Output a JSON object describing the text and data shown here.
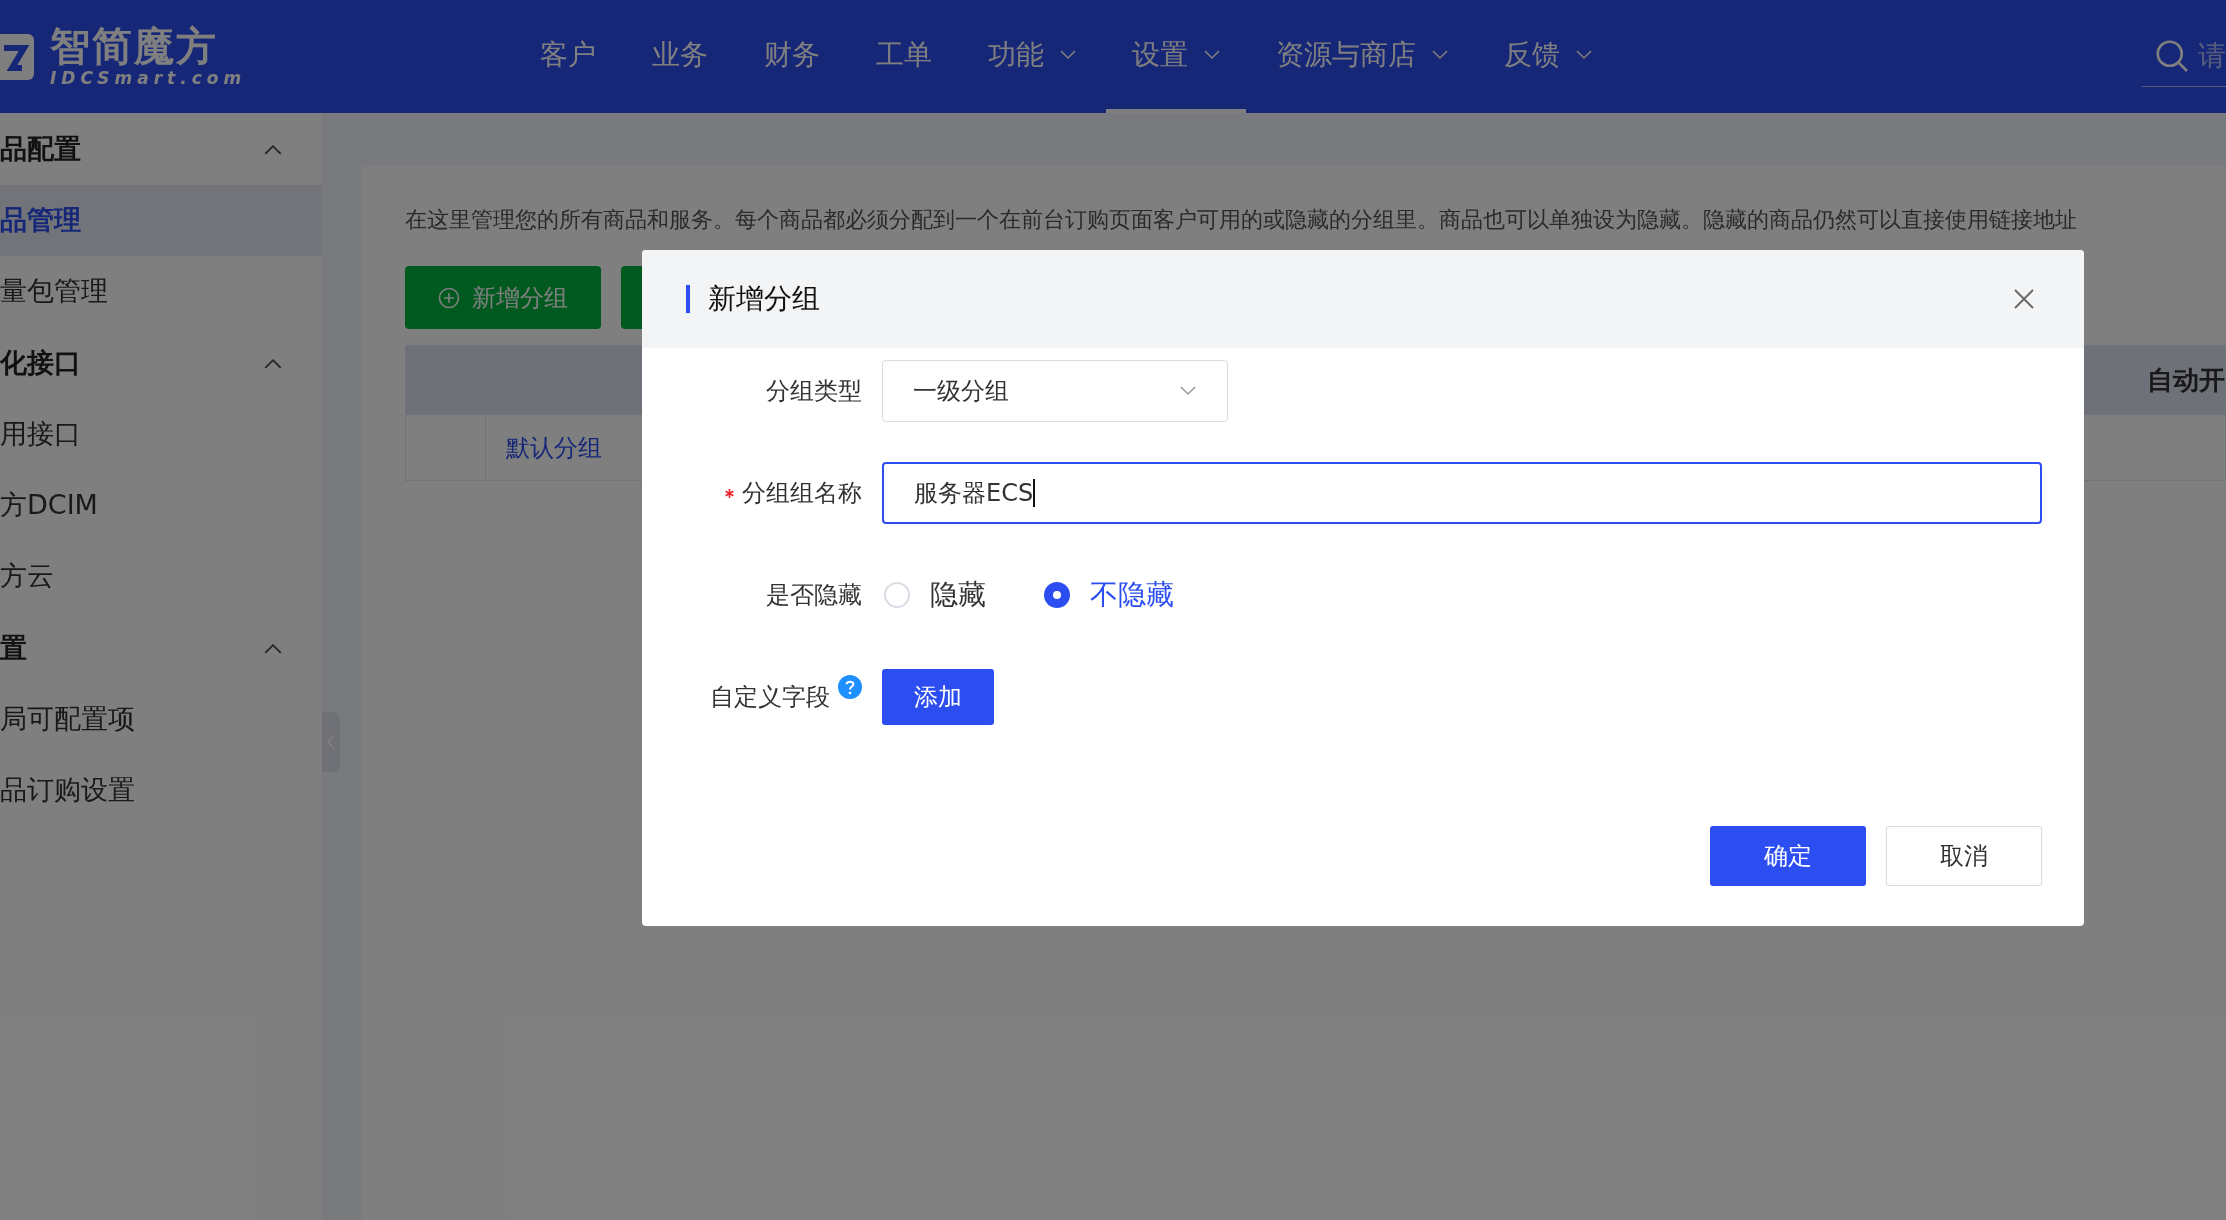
{
  "header": {
    "logo": {
      "name": "智简魔方",
      "domain": "IDCSmart.com"
    },
    "nav": [
      {
        "label": "客户",
        "has_menu": false,
        "selected": false
      },
      {
        "label": "业务",
        "has_menu": false,
        "selected": false
      },
      {
        "label": "财务",
        "has_menu": false,
        "selected": false
      },
      {
        "label": "工单",
        "has_menu": false,
        "selected": false
      },
      {
        "label": "功能",
        "has_menu": true,
        "selected": false
      },
      {
        "label": "设置",
        "has_menu": true,
        "selected": true
      },
      {
        "label": "资源与商店",
        "has_menu": true,
        "selected": false
      },
      {
        "label": "反馈",
        "has_menu": true,
        "selected": false
      }
    ],
    "search": {
      "placeholder": "请"
    }
  },
  "sidebar": {
    "groups": [
      {
        "title": "品配置",
        "expanded": true,
        "items": [
          {
            "label": "品管理",
            "selected": true
          },
          {
            "label": "量包管理",
            "selected": false
          }
        ]
      },
      {
        "title": "化接口",
        "expanded": true,
        "items": [
          {
            "label": "用接口",
            "selected": false
          },
          {
            "label": "方DCIM",
            "selected": false
          },
          {
            "label": "方云",
            "selected": false
          }
        ]
      },
      {
        "title": "置",
        "expanded": true,
        "items": [
          {
            "label": "局可配置项",
            "selected": false
          },
          {
            "label": "品订购设置",
            "selected": false
          }
        ]
      }
    ]
  },
  "content": {
    "description": "在这里管理您的所有商品和服务。每个商品都必须分配到一个在前台订购页面客户可用的或隐藏的分组里。商品也可以单独设为隐藏。隐藏的商品仍然可以直接使用链接地址",
    "add_button": "新增分组",
    "table": {
      "last_column": "自动开",
      "rows": [
        {
          "name": "默认分组"
        }
      ]
    }
  },
  "dialog": {
    "title": "新增分组",
    "fields": [
      {
        "kind": "select",
        "label": "分组类型",
        "value": "一级分组",
        "required": false,
        "focused": false
      },
      {
        "kind": "text",
        "label": "分组组名称",
        "value": "服务器ECS",
        "required": true,
        "focused": true
      },
      {
        "kind": "radio",
        "label": "是否隐藏",
        "required": false,
        "options": [
          {
            "label": "隐藏",
            "selected": false
          },
          {
            "label": "不隐藏",
            "selected": true
          }
        ]
      },
      {
        "kind": "button",
        "label": "自定义字段",
        "required": false,
        "help": true,
        "button": "添加"
      }
    ],
    "buttons": [
      {
        "label": "确定",
        "kind": "primary"
      },
      {
        "label": "取消",
        "kind": "default"
      }
    ]
  }
}
